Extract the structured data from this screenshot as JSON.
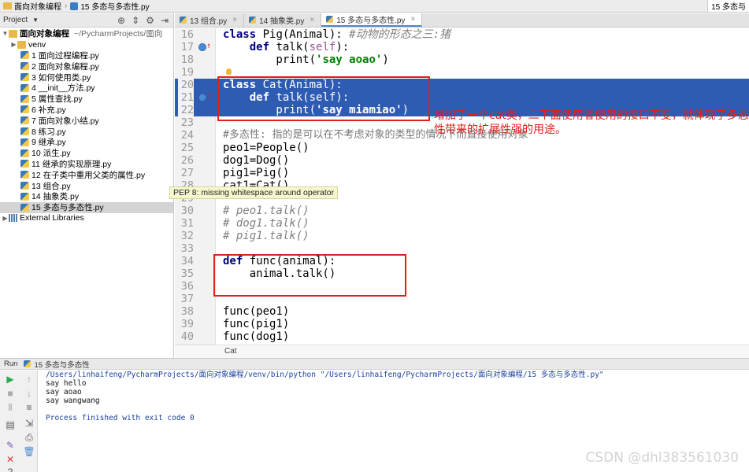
{
  "titlebar": {
    "project": "面向对象编程",
    "file": "15 多态与多态性.py",
    "right_tab": "15 多态与"
  },
  "project_panel": {
    "title": "Project",
    "root": "面向对象编程",
    "root_path": "~/PycharmProjects/面向",
    "venv": "venv",
    "files": [
      "1 面向过程编程.py",
      "2 面向对象编程.py",
      "3 如何使用类.py",
      "4 __init__方法.py",
      "5 属性查找.py",
      "6 补充.py",
      "7 面向对象小结.py",
      "8 练习.py",
      "9 继承.py",
      "10 派生.py",
      "11 继承的实现原理.py",
      "12 在子类中重用父类的属性.py",
      "13 组合.py",
      "14 抽象类.py",
      "15 多态与多态性.py"
    ],
    "libs": "External Libraries"
  },
  "tabs": [
    {
      "label": "13 组合.py"
    },
    {
      "label": "14 抽象类.py"
    },
    {
      "label": "15 多态与多态性.py"
    }
  ],
  "code": {
    "l16": {
      "n": "16",
      "a": "class",
      "b": " Pig(Animal): ",
      "c": "#动物的形态之三:猪"
    },
    "l17": {
      "n": "17",
      "a": "    def",
      "b": " talk(",
      "s": "self",
      "d": "):"
    },
    "l18": {
      "n": "18",
      "a": "        print(",
      "str": "'say aoao'",
      "d": ")"
    },
    "l19": {
      "n": "19"
    },
    "l20": {
      "n": "20",
      "a": "class",
      "b": " Cat(Animal):"
    },
    "l21": {
      "n": "21",
      "a": "    def",
      "b": " talk(self):"
    },
    "l22": {
      "n": "22",
      "a": "        print(",
      "str": "'say miamiao'",
      "d": ")"
    },
    "l23": {
      "n": "23"
    },
    "l24": {
      "n": "24",
      "c": "#多态性: 指的是可以在不考虑对象的类型的情况下而直接使用对象"
    },
    "l25": {
      "n": "25",
      "t": "peo1=People()"
    },
    "l26": {
      "n": "26",
      "t": "dog1=Dog()"
    },
    "l27": {
      "n": "27",
      "t": "pig1=Pig()"
    },
    "l28": {
      "n": "28",
      "t": "cat1=Cat()"
    },
    "l29": {
      "n": "29"
    },
    "l30": {
      "n": "30",
      "c": "# peo1.talk()"
    },
    "l31": {
      "n": "31",
      "c": "# dog1.talk()"
    },
    "l32": {
      "n": "32",
      "c": "# pig1.talk()"
    },
    "l33": {
      "n": "33"
    },
    "l34": {
      "n": "34",
      "a": "def",
      "b": " func(animal):"
    },
    "l35": {
      "n": "35",
      "t": "    animal.talk()"
    },
    "l36": {
      "n": "36"
    },
    "l37": {
      "n": "37"
    },
    "l38": {
      "n": "38",
      "t": "func(peo1)"
    },
    "l39": {
      "n": "39",
      "t": "func(pig1)"
    },
    "l40": {
      "n": "40",
      "t": "func(dog1)"
    }
  },
  "annotation": "增加了一个cat类，二下面使用者使用的接口不变，就体现了多态性带来的扩展性强的用途。",
  "tooltip": "PEP 8: missing whitespace around operator",
  "breadcrumb_status": "Cat",
  "run": {
    "label": "Run",
    "config": "15 多态与多态性",
    "cmd": "/Users/linhaifeng/PycharmProjects/面向对象编程/venv/bin/python \"/Users/linhaifeng/PycharmProjects/面向对象编程/15 多态与多态性.py\"",
    "out1": "say hello",
    "out2": "say aoao",
    "out3": "say wangwang",
    "finished": "Process finished with exit code 0"
  },
  "watermark": "CSDN @dhl383561030"
}
